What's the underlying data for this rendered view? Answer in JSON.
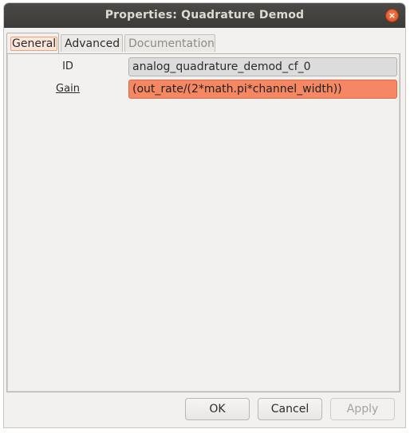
{
  "window": {
    "title": "Properties: Quadrature Demod",
    "close_icon_glyph": "×"
  },
  "tabs": [
    {
      "label": "General",
      "state": "active"
    },
    {
      "label": "Advanced",
      "state": "normal"
    },
    {
      "label": "Documentation",
      "state": "disabled"
    }
  ],
  "properties": {
    "id": {
      "label": "ID",
      "value": "analog_quadrature_demod_cf_0"
    },
    "gain": {
      "label": "Gain",
      "value": "(out_rate/(2*math.pi*channel_width))"
    }
  },
  "buttons": {
    "ok": "OK",
    "cancel": "Cancel",
    "apply": "Apply"
  },
  "colors": {
    "titlebar": "#3c3b37",
    "close_button": "#e0561f",
    "gain_field_error": "#f68763",
    "id_field_bg": "#dcdcdc"
  },
  "icons": {
    "close": "close-icon"
  }
}
